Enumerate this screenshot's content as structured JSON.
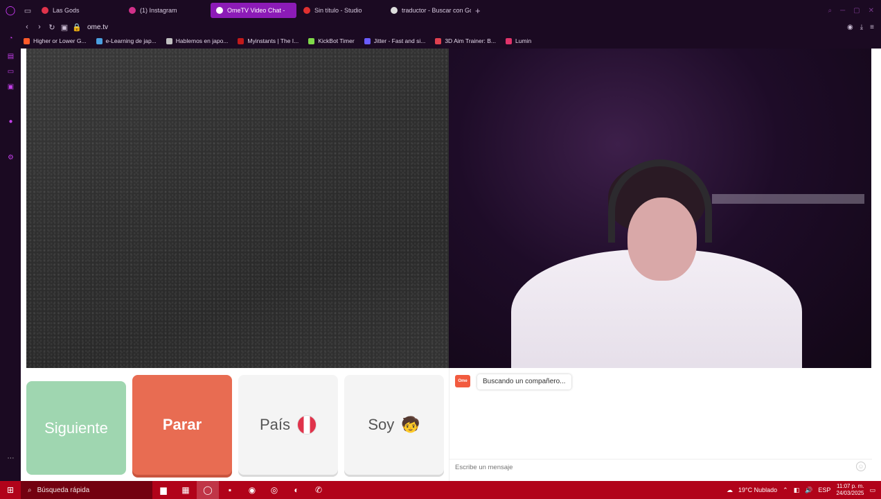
{
  "browser": {
    "tabs": [
      {
        "label": "Las Gods",
        "color": "#e0334b"
      },
      {
        "label": "(1) Instagram",
        "color": "#d1308a"
      },
      {
        "label": "OmeTV Video Chat -",
        "color": "#ffffff"
      },
      {
        "label": "Sin título - Studio",
        "color": "#e03030"
      },
      {
        "label": "traductor - Buscar con Go",
        "color": "#dddddd"
      }
    ],
    "new_tab": "+",
    "url": "ome.tv",
    "bookmarks": [
      {
        "label": "Higher or Lower G...",
        "color": "#ff5a2a"
      },
      {
        "label": "e-Learning de jap...",
        "color": "#4a9fe0"
      },
      {
        "label": "Hablemos en japo...",
        "color": "#c0c0c0"
      },
      {
        "label": "Myinstants | The I...",
        "color": "#c21a1a"
      },
      {
        "label": "KickBot Timer",
        "color": "#7fd84a"
      },
      {
        "label": "Jitter - Fast and si...",
        "color": "#6a5cff"
      },
      {
        "label": "3D Aim Trainer: B...",
        "color": "#e04050"
      },
      {
        "label": "Lumin",
        "color": "#e0336a"
      }
    ]
  },
  "controls": {
    "next": "Siguiente",
    "stop": "Parar",
    "country": "País",
    "soy": "Soy",
    "soy_emoji": "🧒"
  },
  "chat": {
    "logo": "Ome TV",
    "status": "Buscando un compañero...",
    "placeholder": "Escribe un mensaje",
    "emoji": "☺"
  },
  "taskbar": {
    "search": "Búsqueda rápida",
    "weather": "19°C  Nublado",
    "lang": "ESP",
    "time": "11:07 p. m.",
    "date": "24/03/2025"
  }
}
